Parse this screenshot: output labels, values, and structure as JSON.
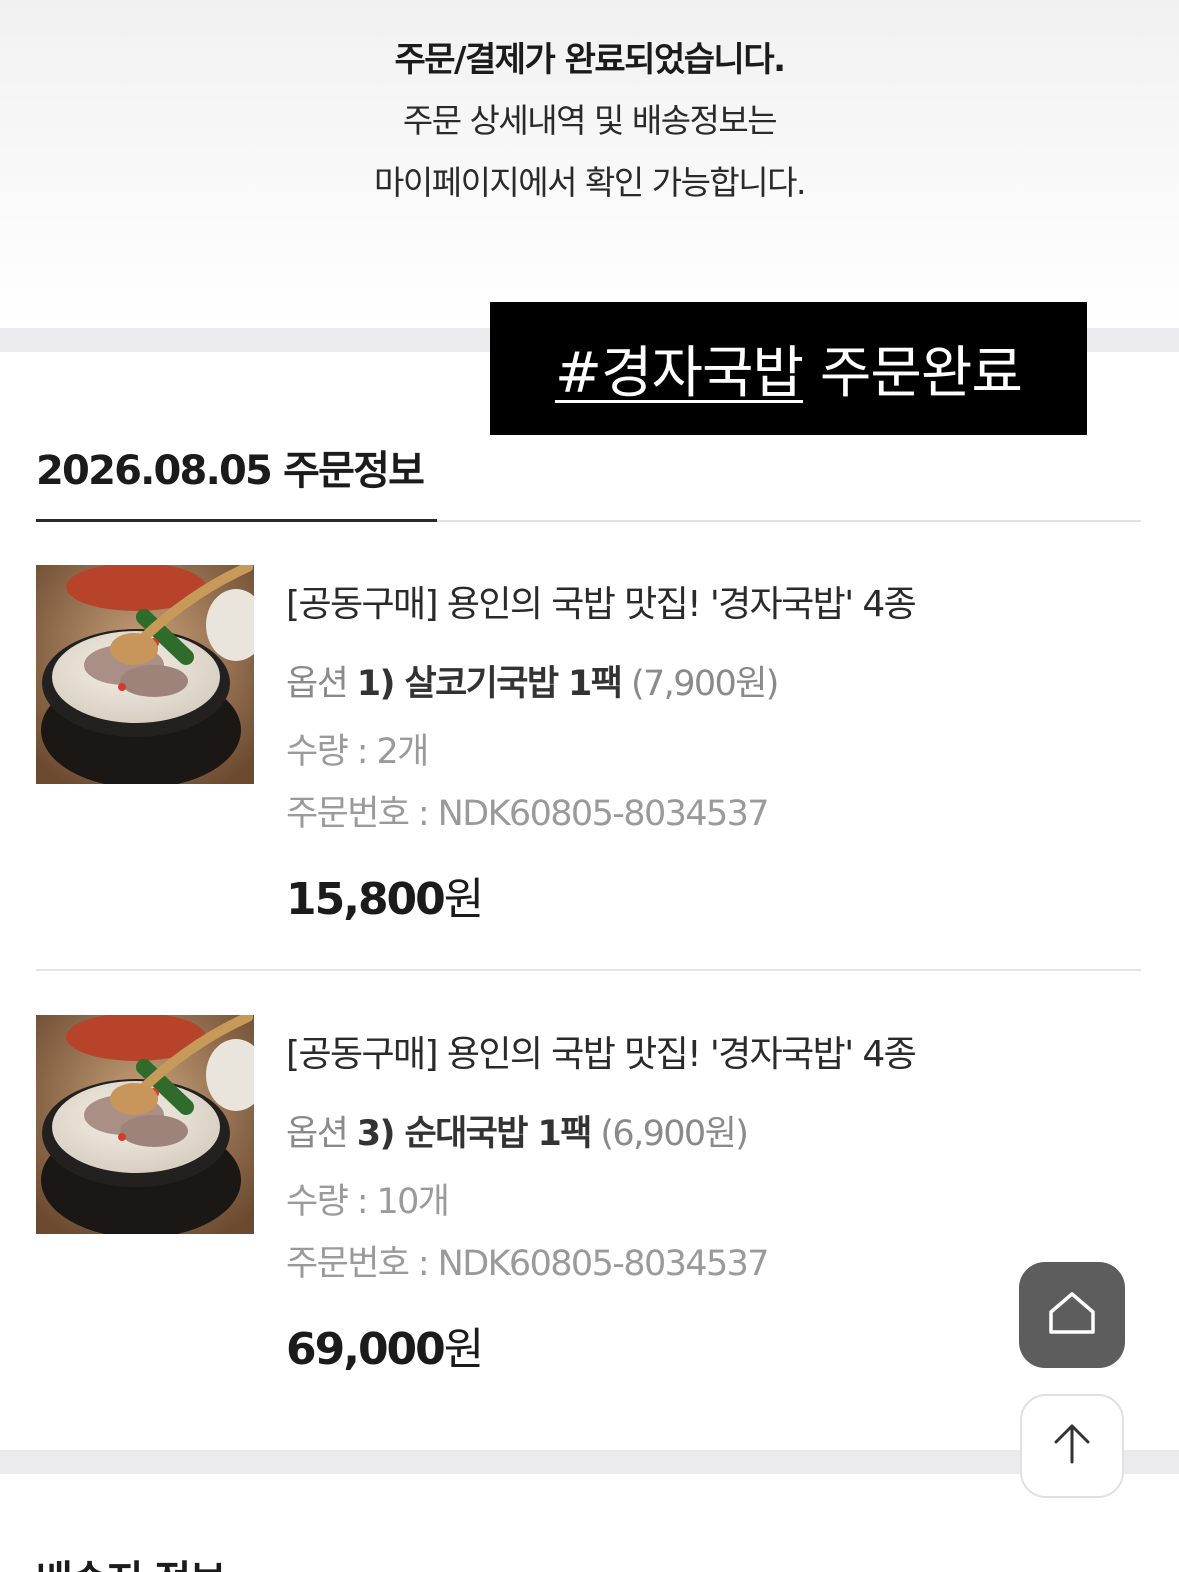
{
  "banner": {
    "title": "주문/결제가 완료되었습니다.",
    "line1": "주문 상세내역 및 배송정보는",
    "line2": "마이페이지에서 확인 가능합니다."
  },
  "overlay": {
    "hashtag": "#경자국밥",
    "suffix": " 주문완료"
  },
  "order": {
    "header": "2026.08.05 주문정보",
    "items": [
      {
        "title": "[공동구매] 용인의 국밥 맛집! '경자국밥' 4종",
        "option_label": "옵션",
        "option_name": "1) 살코기국밥 1팩",
        "option_price": "(7,900원)",
        "quantity": "수량 : 2개",
        "order_number": "주문번호 : NDK60805-8034537",
        "price_number": "15,800",
        "price_unit": "원"
      },
      {
        "title": "[공동구매] 용인의 국밥 맛집! '경자국밥' 4종",
        "option_label": "옵션",
        "option_name": "3) 순대국밥 1팩",
        "option_price": "(6,900원)",
        "quantity": "수량 : 10개",
        "order_number": "주문번호 : NDK60805-8034537",
        "price_number": "69,000",
        "price_unit": "원"
      }
    ]
  },
  "next_section_title": "배송지 정보",
  "floating": {
    "home_icon": "home-icon",
    "top_icon": "arrow-up-icon"
  }
}
